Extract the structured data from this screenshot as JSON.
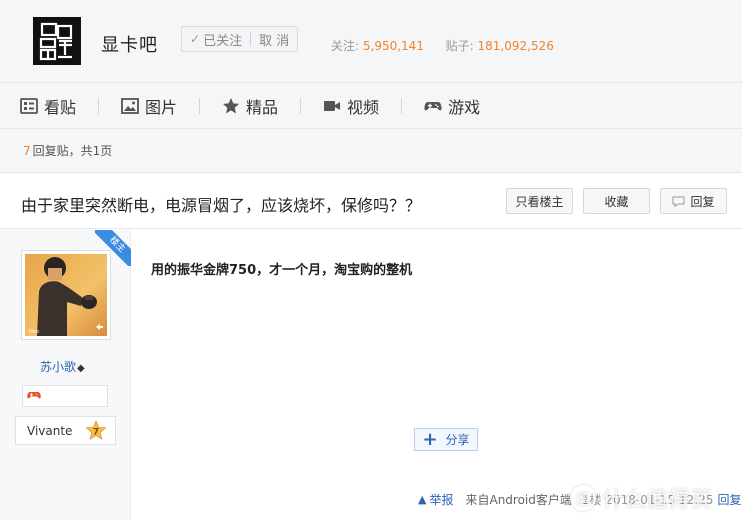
{
  "header": {
    "forum_name": "显卡吧",
    "follow_label": "已关注",
    "cancel_label": "取 消",
    "followers_label": "关注:",
    "followers_count": "5,950,141",
    "posts_label": "贴子:",
    "posts_count": "181,092,526"
  },
  "nav": {
    "items": [
      {
        "label": "看贴",
        "icon": "list-icon"
      },
      {
        "label": "图片",
        "icon": "image-icon"
      },
      {
        "label": "精品",
        "icon": "star-icon"
      },
      {
        "label": "视频",
        "icon": "video-icon"
      },
      {
        "label": "游戏",
        "icon": "gamepad-icon"
      }
    ]
  },
  "reply_bar": {
    "count": "7",
    "text": "回复贴，共1页"
  },
  "thread": {
    "title": "由于家里突然断电，电源冒烟了，应该烧坏，保修吗？？",
    "only_op_label": "只看楼主",
    "favorite_label": "收藏",
    "reply_label": "回复"
  },
  "post": {
    "op_tag": "楼主",
    "username": "苏小歌",
    "level_name": "Vivante",
    "level_number": "7",
    "content": "用的振华金牌750，才一个月，淘宝购的整机",
    "share_label": "分享",
    "report_label": "举报",
    "source_text": "来自Android客户端",
    "meta_faded": "1楼 2018-01-15 12:25",
    "reply_link": "回复"
  },
  "watermark": {
    "text": "什么值得买",
    "symbol": "值"
  }
}
